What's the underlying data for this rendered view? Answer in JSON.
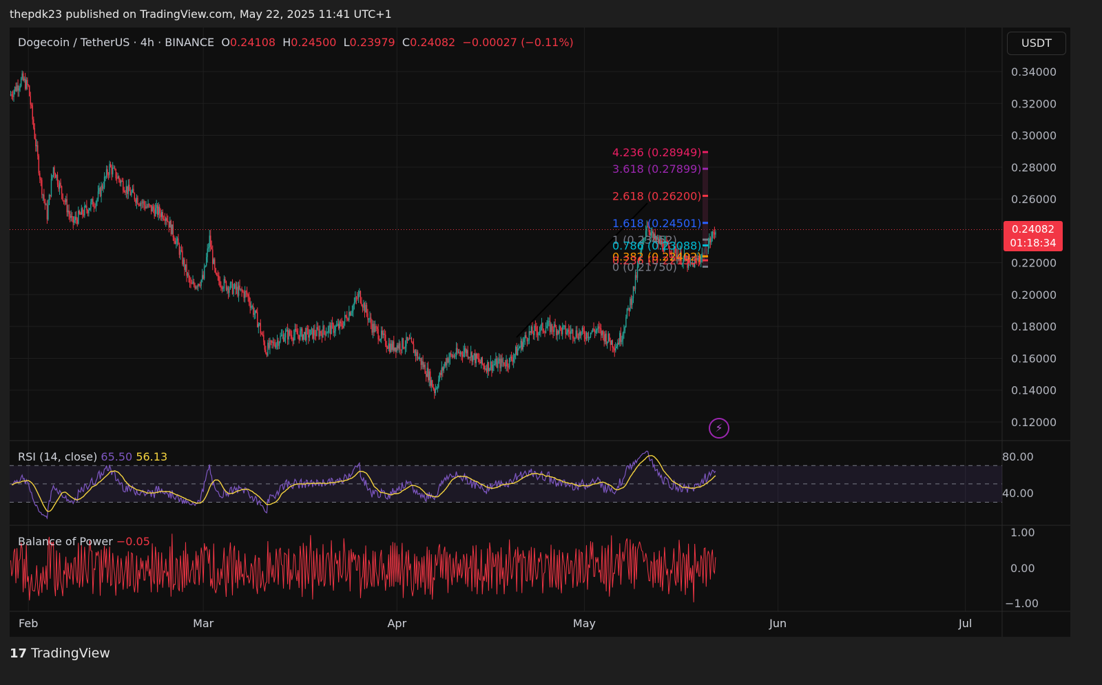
{
  "header": {
    "text": "thepdk23 published on TradingView.com, May 22, 2025 11:41 UTC+1"
  },
  "legend": {
    "symbol": "Dogecoin / TetherUS · 4h · BINANCE",
    "o_label": "O",
    "o": "0.24108",
    "h_label": "H",
    "h": "0.24500",
    "l_label": "L",
    "l": "0.23979",
    "c_label": "C",
    "c": "0.24082",
    "change": "−0.00027 (−0.11%)"
  },
  "currency_button": "USDT",
  "last_price": {
    "price": "0.24082",
    "countdown": "01:18:34"
  },
  "colors": {
    "up": "#26a69a",
    "down": "#f23645",
    "rsi": "#7e57c2",
    "rsi_ma": "#f5d440",
    "bop": "#f23645"
  },
  "rsi": {
    "label": "RSI (14, close)",
    "value": "65.50",
    "ma": "56.13",
    "ticks": [
      "80.00",
      "40.00"
    ]
  },
  "bop": {
    "label": "Balance of Power",
    "value": "−0.05",
    "ticks": [
      "1.00",
      "0.00",
      "−1.00"
    ]
  },
  "footer": {
    "brand": "TradingView"
  },
  "chart_data": {
    "type": "candlestick",
    "title": "Dogecoin / TetherUS 4h BINANCE",
    "ylim": [
      0.11,
      0.35
    ],
    "y_ticks": [
      "0.34000",
      "0.32000",
      "0.30000",
      "0.28000",
      "0.26000",
      "0.22000",
      "0.20000",
      "0.18000",
      "0.16000",
      "0.14000",
      "0.12000"
    ],
    "y_tick_values": [
      0.34,
      0.32,
      0.3,
      0.28,
      0.26,
      0.22,
      0.2,
      0.18,
      0.16,
      0.14,
      0.12
    ],
    "x_ticks": [
      "Feb",
      "Mar",
      "Apr",
      "May",
      "Jun",
      "Jul"
    ],
    "x_tick_days": [
      3,
      31,
      62,
      92,
      123,
      153
    ],
    "price_path": [
      [
        0,
        0.325
      ],
      [
        2,
        0.335
      ],
      [
        3,
        0.33
      ],
      [
        5,
        0.27
      ],
      [
        6,
        0.25
      ],
      [
        7,
        0.28
      ],
      [
        10,
        0.245
      ],
      [
        14,
        0.26
      ],
      [
        16,
        0.28
      ],
      [
        19,
        0.265
      ],
      [
        22,
        0.255
      ],
      [
        25,
        0.25
      ],
      [
        27,
        0.23
      ],
      [
        29,
        0.205
      ],
      [
        31,
        0.21
      ],
      [
        32,
        0.235
      ],
      [
        33,
        0.21
      ],
      [
        35,
        0.205
      ],
      [
        38,
        0.2
      ],
      [
        40,
        0.18
      ],
      [
        41,
        0.165
      ],
      [
        44,
        0.175
      ],
      [
        48,
        0.175
      ],
      [
        53,
        0.18
      ],
      [
        56,
        0.2
      ],
      [
        58,
        0.18
      ],
      [
        61,
        0.167
      ],
      [
        64,
        0.17
      ],
      [
        67,
        0.15
      ],
      [
        68,
        0.14
      ],
      [
        70,
        0.16
      ],
      [
        73,
        0.165
      ],
      [
        76,
        0.155
      ],
      [
        80,
        0.158
      ],
      [
        83,
        0.175
      ],
      [
        86,
        0.18
      ],
      [
        89,
        0.177
      ],
      [
        92,
        0.175
      ],
      [
        94,
        0.178
      ],
      [
        97,
        0.168
      ],
      [
        98,
        0.175
      ],
      [
        100,
        0.205
      ],
      [
        101,
        0.225
      ],
      [
        102,
        0.245
      ],
      [
        103,
        0.235
      ],
      [
        105,
        0.23
      ],
      [
        107,
        0.225
      ],
      [
        109,
        0.218
      ],
      [
        111,
        0.225
      ],
      [
        113,
        0.2408
      ]
    ],
    "fib_levels": [
      {
        "label": "4.236 (0.28949)",
        "price": 0.28949,
        "color": "#e91e63"
      },
      {
        "label": "3.618 (0.27899)",
        "price": 0.27899,
        "color": "#9c27b0"
      },
      {
        "label": "2.618 (0.26200)",
        "price": 0.262,
        "color": "#f23645"
      },
      {
        "label": "1.618 (0.24501)",
        "price": 0.24501,
        "color": "#2962ff"
      },
      {
        "label": "1 (0.23452)",
        "price": 0.23452,
        "color": "#787b86"
      },
      {
        "label": "0.786 (0.23088)",
        "price": 0.23088,
        "color": "#00bcd4"
      },
      {
        "label": "0.382 (0.22402)",
        "price": 0.22402,
        "color": "#ff9800"
      },
      {
        "label": "0.236 (0.22153)",
        "price": 0.22153,
        "color": "#f23645"
      },
      {
        "label": "0 (0.21750)",
        "price": 0.2175,
        "color": "#787b86"
      }
    ],
    "current_price": 0.24082
  }
}
